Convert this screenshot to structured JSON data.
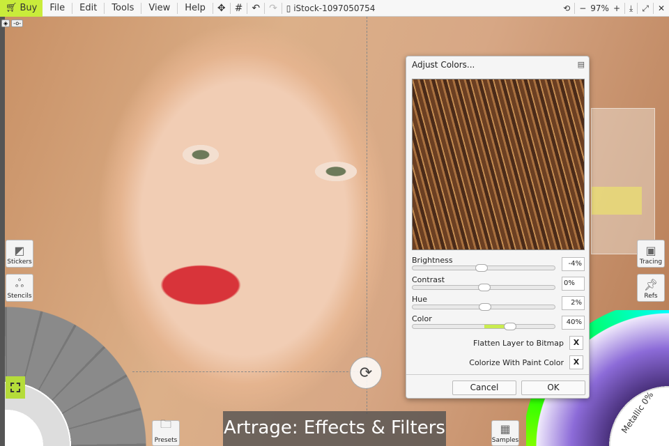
{
  "menubar": {
    "buy": "Buy",
    "items": [
      "File",
      "Edit",
      "Tools",
      "View",
      "Help"
    ],
    "document_title": "iStock-1097050754",
    "zoom": "97%",
    "zoom_minus": "−",
    "zoom_plus": "+"
  },
  "side_buttons": {
    "stickers": "Stickers",
    "stencils": "Stencils",
    "presets": "Presets",
    "samples": "Samples",
    "tracing": "Tracing",
    "refs": "Refs"
  },
  "dialog": {
    "title": "Adjust Colors...",
    "sliders": [
      {
        "label": "Brightness",
        "value": "-4%",
        "position": -0.04
      },
      {
        "label": "Contrast",
        "value": "0%",
        "position": 0
      },
      {
        "label": "Hue",
        "value": "2%",
        "position": 0.02
      },
      {
        "label": "Color",
        "value": "40%",
        "position": 0.4
      }
    ],
    "options": [
      {
        "label": "Flatten Layer to Bitmap",
        "mark": "X"
      },
      {
        "label": "Colorize With Paint Color",
        "mark": "X"
      }
    ],
    "cancel": "Cancel",
    "ok": "OK"
  },
  "color_picker": {
    "metallic": "Metallic 0%"
  },
  "caption": "Artrage: Effects & Filters",
  "colors": {
    "accent": "#c9ec3b"
  }
}
